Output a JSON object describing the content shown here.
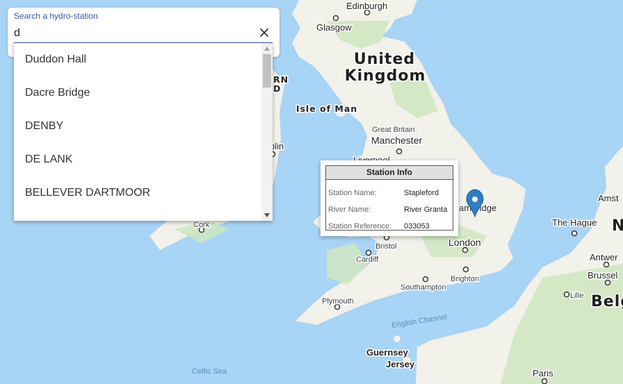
{
  "search": {
    "label": "Search a hydro-station",
    "value": "d",
    "options": [
      "Duddon Hall",
      "Dacre Bridge",
      "DENBY",
      "DE LANK",
      "BELLEVER DARTMOOR"
    ]
  },
  "info_window": {
    "title": "Station Info",
    "rows": [
      {
        "key": "Station Name:",
        "value": "Stapleford"
      },
      {
        "key": "River Name:",
        "value": "River Granta"
      },
      {
        "key": "Station Reference:",
        "value": "033053"
      }
    ]
  },
  "map": {
    "country": [
      "United",
      "Kingdom"
    ],
    "regions": {
      "isle_of_man": "Isle of Man",
      "belgium": "Belgi",
      "netherlands_partial": "N"
    },
    "cities": {
      "edinburgh": "Edinburgh",
      "glasgow": "Glasgow",
      "great_britain": "Great Britain",
      "manchester": "Manchester",
      "liverpool": "Liverpool",
      "dublin": "blin",
      "cork": "Cork",
      "bristol": "Bristol",
      "cardiff": "Cardiff",
      "london": "London",
      "brighton": "Brighton",
      "southampton": "Southampton",
      "plymouth": "Plymouth",
      "cambridge": "ambridge",
      "the_hague": "The Hague",
      "amsterdam": "Amst",
      "antwerp": "Antwer",
      "brussels": "Brussel",
      "lille": "Lille",
      "paris": "Paris",
      "guernsey": "Guernsey",
      "jersey": "Jersey",
      "ireland_partial": "RN\nD"
    },
    "seas": {
      "english_channel": "English Channel",
      "celtic_sea": "Celtic Sea"
    },
    "colors": {
      "sea": "#a8d4f5",
      "land": "#f4f3ee",
      "green": "#cfe6c0",
      "marker": "#2f7ec2",
      "accent": "#3f51b5"
    }
  }
}
